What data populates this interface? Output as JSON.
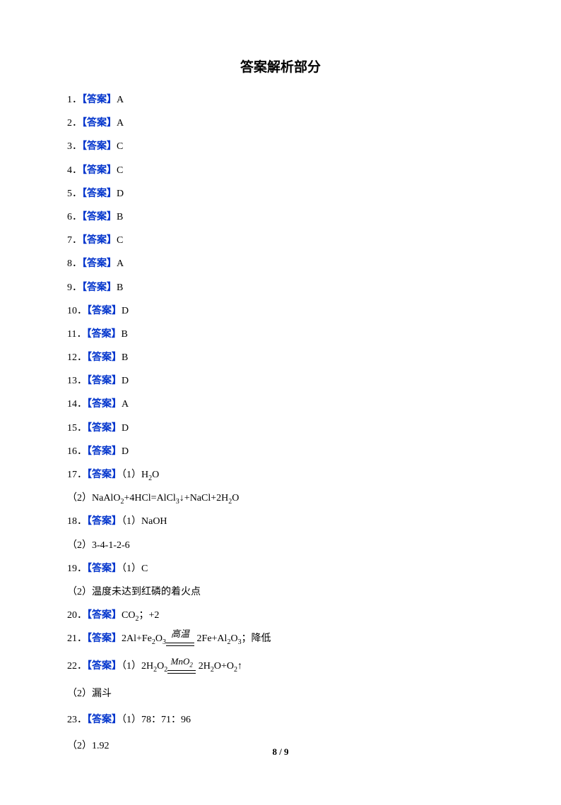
{
  "title": "答案解析部分",
  "answer_label": "【答案】",
  "items": {
    "q1": {
      "num": "1．",
      "val": "A"
    },
    "q2": {
      "num": "2．",
      "val": "A"
    },
    "q3": {
      "num": "3．",
      "val": "C"
    },
    "q4": {
      "num": "4．",
      "val": "C"
    },
    "q5": {
      "num": "5．",
      "val": "D"
    },
    "q6": {
      "num": "6．",
      "val": "B"
    },
    "q7": {
      "num": "7．",
      "val": "C"
    },
    "q8": {
      "num": "8．",
      "val": "A"
    },
    "q9": {
      "num": "9．",
      "val": "B"
    },
    "q10": {
      "num": "10．",
      "val": "D"
    },
    "q11": {
      "num": "11．",
      "val": "B"
    },
    "q12": {
      "num": "12．",
      "val": "B"
    },
    "q13": {
      "num": "13．",
      "val": "D"
    },
    "q14": {
      "num": "14．",
      "val": "A"
    },
    "q15": {
      "num": "15．",
      "val": "D"
    },
    "q16": {
      "num": "16．",
      "val": "D"
    },
    "q17": {
      "num": "17．",
      "part1_prefix": "（1）"
    },
    "q17_2": {
      "prefix": "（2）"
    },
    "q18": {
      "num": "18．",
      "part1_prefix": "（1）NaOH"
    },
    "q18_2": {
      "prefix": "（2）3-4-1-2-6"
    },
    "q19": {
      "num": "19．",
      "part1_prefix": "（1）C"
    },
    "q19_2": {
      "prefix": "（2）温度未达到红磷的着火点"
    },
    "q20": {
      "num": "20．"
    },
    "q21": {
      "num": "21．",
      "condition": "高温",
      "suffix": "；降低"
    },
    "q22": {
      "num": "22．",
      "part1_prefix": "（1）"
    },
    "q22_cond": "MnO",
    "q22_cond_sub": "2",
    "q22_2": {
      "prefix": "（2）漏斗"
    },
    "q23": {
      "num": "23．",
      "part1_prefix": "（1）78：71：96"
    },
    "q23_2": {
      "prefix": "（2）1.92"
    }
  },
  "chem": {
    "h2o": {
      "H": "H",
      "two": "2",
      "O": "O"
    },
    "q17_2_text_a": "NaAlO",
    "q17_2_sub1": "2",
    "q17_2_text_b": "+4HCl=AlCl",
    "q17_2_sub2": "3",
    "q17_2_text_c": "↓+NaCl+2H",
    "q17_2_sub3": "2",
    "q17_2_text_d": "O",
    "q20_a": "CO",
    "q20_sub1": "2",
    "q20_b": "；+2",
    "q21_a": "2Al+Fe",
    "q21_sub1": "2",
    "q21_b": "O",
    "q21_sub2": "3",
    "q21_c": " 2Fe+Al",
    "q21_sub3": "2",
    "q21_d": "O",
    "q21_sub4": "3",
    "q22_a": "2H",
    "q22_sub1": "2",
    "q22_b": "O",
    "q22_sub2": "2",
    "q22_c": " 2H",
    "q22_sub3": "2",
    "q22_d": "O+O",
    "q22_sub4": "2",
    "q22_e": "↑"
  },
  "footer": "8 / 9"
}
